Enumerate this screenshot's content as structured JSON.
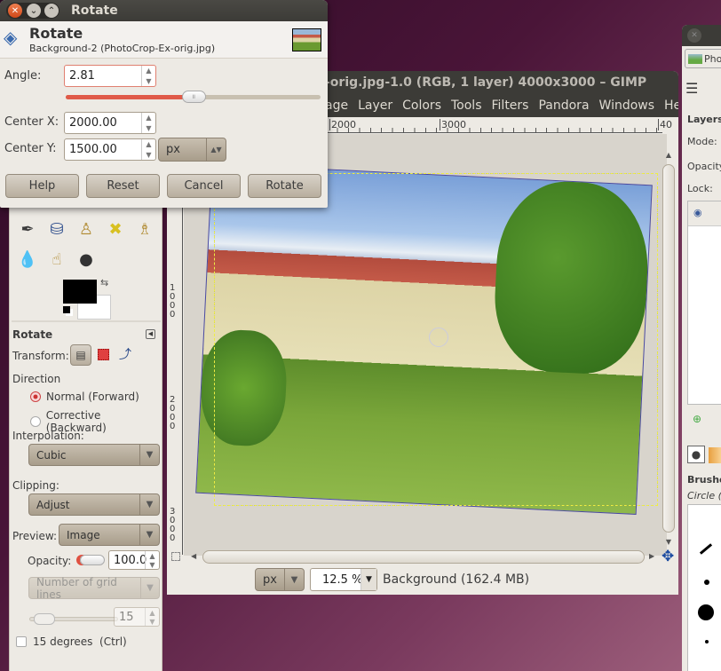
{
  "image_window": {
    "title": "-orig.jpg-1.0 (RGB, 1 layer) 4000x3000 – GIMP",
    "menu": [
      "age",
      "Layer",
      "Colors",
      "Tools",
      "Filters",
      "Pandora",
      "Windows",
      "Help"
    ],
    "hruler_labels": [
      "00",
      "2000",
      "3000",
      "40"
    ],
    "vruler_labels": [
      "1\n0\n0\n0",
      "2\n0\n0\n0",
      "3\n0\n0\n0"
    ],
    "status": {
      "unit": "px",
      "zoom": "12.5 %",
      "layer_info": "Background (162.4 MB)"
    }
  },
  "dialog": {
    "window_title": "Rotate",
    "heading": "Rotate",
    "subheading": "Background-2 (PhotoCrop-Ex-orig.jpg)",
    "angle_label": "Angle:",
    "angle_value": "2.81",
    "angle_slider_fraction": 0.5,
    "center_x_label": "Center X:",
    "center_x_value": "2000.00",
    "center_y_label": "Center Y:",
    "center_y_value": "1500.00",
    "unit": "px",
    "buttons": {
      "help": "Help",
      "reset": "Reset",
      "cancel": "Cancel",
      "rotate": "Rotate"
    }
  },
  "toolbox": {
    "options_title": "Rotate",
    "transform_label": "Transform:",
    "direction_label": "Direction",
    "direction_normal": "Normal (Forward)",
    "direction_corrective": "Corrective (Backward)",
    "direction_selected": "normal",
    "interpolation_label": "Interpolation:",
    "interpolation_value": "Cubic",
    "clipping_label": "Clipping:",
    "clipping_value": "Adjust",
    "preview_label": "Preview:",
    "preview_value": "Image",
    "opacity_label": "Opacity:",
    "opacity_value": "100.0",
    "grid_value": "Number of grid lines",
    "grid_count": "15",
    "degrees_label": "15 degrees  (Ctrl)",
    "fg_color": "#000000",
    "bg_color": "#ffffff"
  },
  "dock": {
    "image_tab": "Pho",
    "layers_title": "Layers",
    "mode_label": "Mode:",
    "opacity_label": "Opacity",
    "lock_label": "Lock:",
    "brushes_title": "Brushe",
    "brush_name": "Circle ("
  }
}
